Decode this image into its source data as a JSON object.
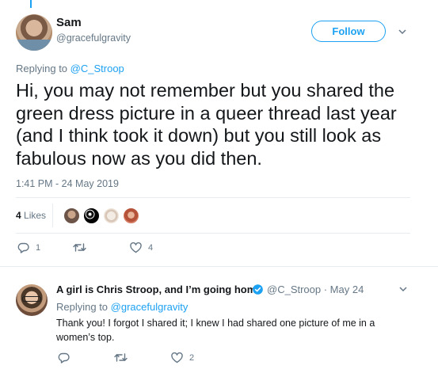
{
  "main_tweet": {
    "author_name": "Sam",
    "author_handle": "@gracefulgravity",
    "follow_label": "Follow",
    "replying_prefix": "Replying to ",
    "replying_to": "@C_Stroop",
    "text": "Hi, you may not remember but you shared the green dress picture in a queer thread last year (and I think took it down) but you still look as fabulous now as you did then.",
    "timestamp": "1:41 PM - 24 May 2019",
    "likes_count": "4",
    "likes_label": "Likes",
    "reply_count": "1",
    "retweet_count": "",
    "like_count": "4"
  },
  "reply_tweet": {
    "author_name": "A girl is Chris Stroop, and I’m going home",
    "author_handle": "@C_Stroop · May 24",
    "replying_prefix": "Replying to ",
    "replying_to": "@gracefulgravity",
    "text": "Thank you! I forgot I shared it; I knew I had shared one picture of me in a women’s top.",
    "reply_count": "",
    "retweet_count": "",
    "like_count": "2"
  },
  "icons": {
    "reply": "reply-icon",
    "retweet": "retweet-icon",
    "like": "heart-icon",
    "caret": "chevron-down-icon",
    "verified": "verified-badge-icon"
  },
  "colors": {
    "accent": "#1da1f2",
    "muted": "#657786",
    "text": "#14171a",
    "divider": "#e6ecf0"
  }
}
